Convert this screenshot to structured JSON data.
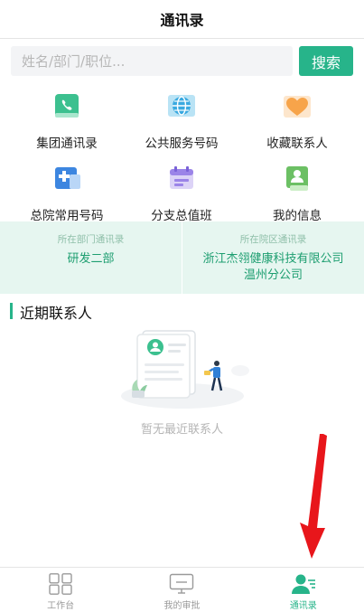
{
  "header": {
    "title": "通讯录"
  },
  "search": {
    "placeholder": "姓名/部门/职位...",
    "button_label": "搜索"
  },
  "grid": {
    "items": [
      {
        "label": "集团通讯录",
        "icon": "book-phone-icon"
      },
      {
        "label": "公共服务号码",
        "icon": "globe-icon"
      },
      {
        "label": "收藏联系人",
        "icon": "heart-icon"
      },
      {
        "label": "总院常用号码",
        "icon": "hospital-icon"
      },
      {
        "label": "分支总值班",
        "icon": "calendar-icon"
      },
      {
        "label": "我的信息",
        "icon": "id-card-icon"
      }
    ]
  },
  "dept": {
    "left": {
      "caption": "所在部门通讯录",
      "value": "研发二部"
    },
    "right": {
      "caption": "所在院区通讯录",
      "line1": "浙江杰翎健康科技有限公司",
      "line2": "温州分公司"
    }
  },
  "recent": {
    "title": "近期联系人",
    "empty_text": "暂无最近联系人"
  },
  "tabs": [
    {
      "label": "工作台",
      "icon": "grid-icon",
      "active": false
    },
    {
      "label": "我的审批",
      "icon": "monitor-icon",
      "active": false
    },
    {
      "label": "通讯录",
      "icon": "contacts-icon",
      "active": true
    }
  ],
  "colors": {
    "accent": "#27b48a",
    "panel": "#e6f6f0",
    "arrow": "#e8161b"
  }
}
